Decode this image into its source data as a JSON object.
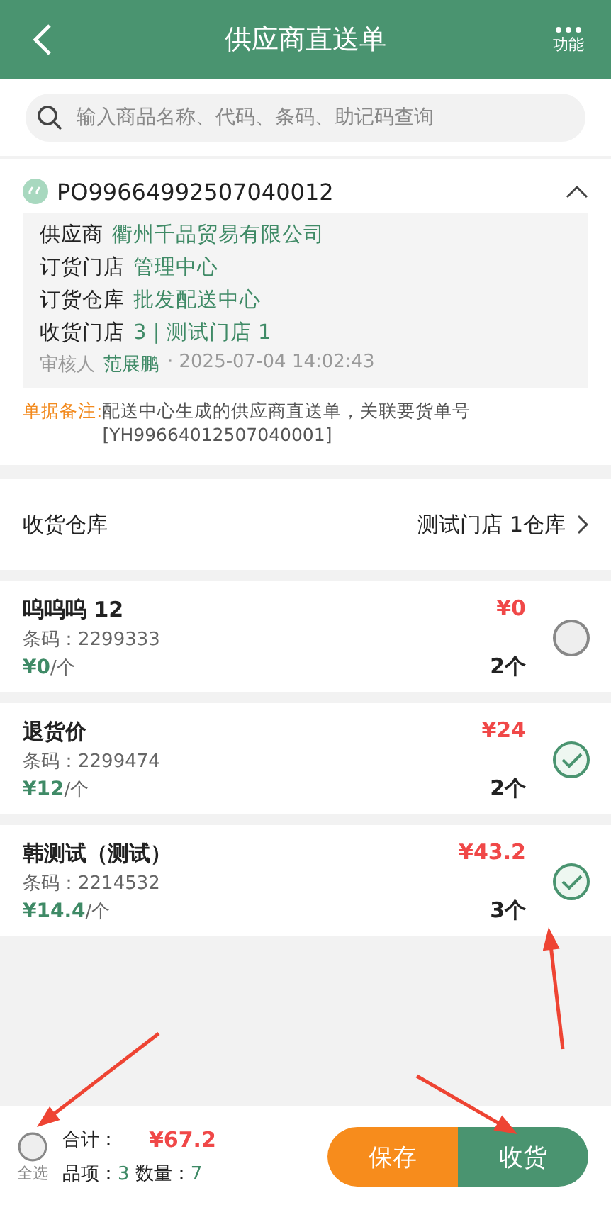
{
  "header": {
    "title": "供应商直送单",
    "menu_label": "功能"
  },
  "search": {
    "placeholder": "输入商品名称、代码、条码、助记码查询"
  },
  "order": {
    "number": "PO99664992507040012",
    "expanded": true,
    "fields": [
      {
        "label": "供应商",
        "value": "衢州千品贸易有限公司"
      },
      {
        "label": "订货门店",
        "value": "管理中心"
      },
      {
        "label": "订货仓库",
        "value": "批发配送中心"
      },
      {
        "label": "收货门店",
        "value": "3 | 测试门店 1"
      }
    ],
    "reviewer_label": "审核人",
    "reviewer": "范展鹏",
    "time": "· 2025-07-04 14:02:43",
    "note_label": "单据备注:",
    "note": "配送中心生成的供应商直送单，关联要货单号[YH99664012507040001]"
  },
  "warehouse": {
    "label": "收货仓库",
    "value": "测试门店 1仓库"
  },
  "items": [
    {
      "name": "呜呜呜 12",
      "barcode": "条码：2299333",
      "price": "¥0",
      "unit": "/个",
      "total": "¥0",
      "qty": "2个",
      "selected": false
    },
    {
      "name": "退货价",
      "barcode": "条码：2299474",
      "price": "¥12",
      "unit": "/个",
      "total": "¥24",
      "qty": "2个",
      "selected": true
    },
    {
      "name": "韩测试（测试）",
      "barcode": "条码：2214532",
      "price": "¥14.4",
      "unit": "/个",
      "total": "¥43.2",
      "qty": "3个",
      "selected": true
    }
  ],
  "footer": {
    "select_all": "全选",
    "select_all_selected": false,
    "total_label": "合计：",
    "total": "¥67.2",
    "items_label": "品项：",
    "items_count": "3",
    "qty_label": "数量：",
    "qty": "7",
    "buttons": [
      "保存",
      "收货"
    ]
  }
}
